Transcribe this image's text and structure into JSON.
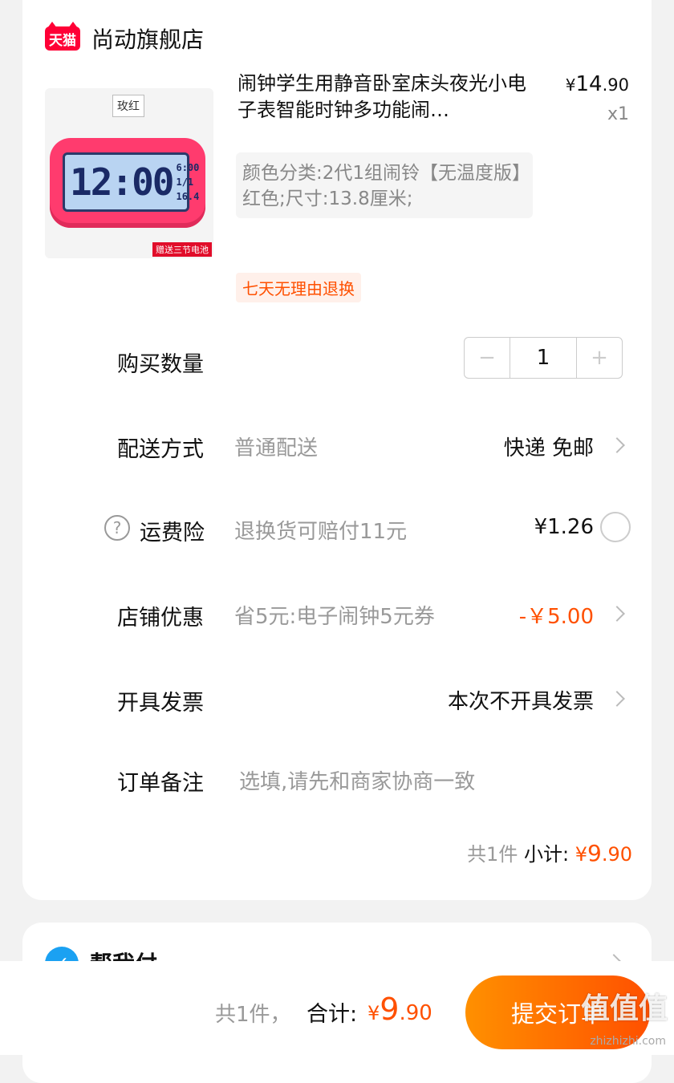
{
  "shop": {
    "logo_text": "天猫",
    "name": "尚动旗舰店"
  },
  "product": {
    "image_tag": "玫红",
    "image_clock_time": "12:00",
    "image_clock_side": [
      "6:00",
      "1/1",
      "16.4"
    ],
    "image_banner": "赠送三节电池",
    "title": "闹钟学生用静音卧室床头夜光小电子表智能时钟多功能闹…",
    "price_yen": "¥",
    "price_int": "14",
    "price_dec": ".90",
    "quantity_label": "x1",
    "sku": "颜色分类:2代1组闹铃【无温度版】红色;尺寸:13.8厘米;",
    "tag_return": "七天无理由退换"
  },
  "quantity": {
    "label": "购买数量",
    "minus": "−",
    "value": "1",
    "plus": "+"
  },
  "delivery": {
    "label": "配送方式",
    "mid": "普通配送",
    "right": "快递 免邮"
  },
  "insurance": {
    "help_icon": "?",
    "label": "运费险",
    "mid": "退换货可赔付11元",
    "right": "¥1.26"
  },
  "discount": {
    "label": "店铺优惠",
    "mid": "省5元:电子闹钟5元券",
    "right": "-￥5.00"
  },
  "invoice": {
    "label": "开具发票",
    "right": "本次不开具发票"
  },
  "note": {
    "label": "订单备注",
    "placeholder": "选填,请先和商家协商一致"
  },
  "subtotal": {
    "count": "共1件",
    "label": "小计:",
    "yen": "¥",
    "int": "9",
    "dec": ".90"
  },
  "pay_for_me": {
    "label": "帮我付"
  },
  "bottom": {
    "count": "共1件，",
    "total_label": "合计:",
    "yen": "¥",
    "int": "9",
    "dec": ".90",
    "submit": "提交订单"
  },
  "watermark": {
    "text": "值值值",
    "url": "zhizhizhi.com"
  },
  "colors": {
    "accent": "#ff5000",
    "tmall_red": "#ff0036",
    "button_start": "#ff9000"
  }
}
